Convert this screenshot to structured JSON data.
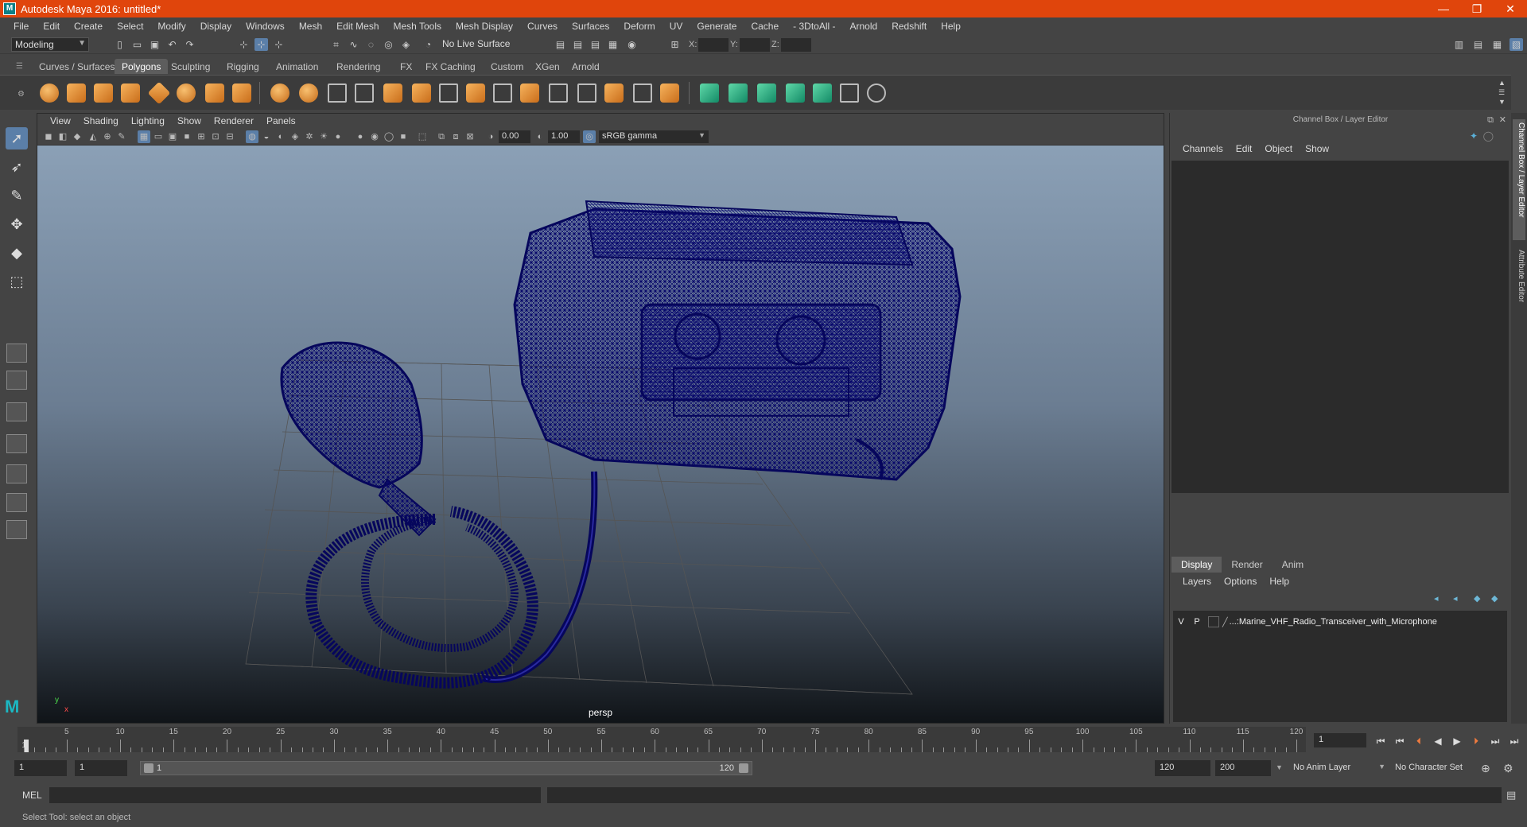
{
  "window": {
    "title": "Autodesk Maya 2016: untitled*",
    "app_icon": "M",
    "minimize": "—",
    "maximize": "❐",
    "close": "✕"
  },
  "menubar": [
    "File",
    "Edit",
    "Create",
    "Select",
    "Modify",
    "Display",
    "Windows",
    "Mesh",
    "Edit Mesh",
    "Mesh Tools",
    "Mesh Display",
    "Curves",
    "Surfaces",
    "Deform",
    "UV",
    "Generate",
    "Cache",
    "- 3DtoAll -",
    "Arnold",
    "Redshift",
    "Help"
  ],
  "statusline": {
    "menuset": "Modeling",
    "live_surface": "No Live Surface",
    "x_label": "X:",
    "y_label": "Y:",
    "z_label": "Z:"
  },
  "shelf_tabs": [
    "Curves / Surfaces",
    "Polygons",
    "Sculpting",
    "Rigging",
    "Animation",
    "Rendering",
    "FX",
    "FX Caching",
    "Custom",
    "XGen",
    "Arnold"
  ],
  "shelf_active_tab": "Polygons",
  "viewport": {
    "menus": [
      "View",
      "Shading",
      "Lighting",
      "Show",
      "Renderer",
      "Panels"
    ],
    "exposure": "0.00",
    "gamma": "1.00",
    "color_space": "sRGB gamma",
    "camera": "persp",
    "axis_y": "y",
    "axis_x": "x"
  },
  "channel_box": {
    "title": "Channel Box / Layer Editor",
    "menus": [
      "Channels",
      "Edit",
      "Object",
      "Show"
    ]
  },
  "layer_editor": {
    "tabs": [
      "Display",
      "Render",
      "Anim"
    ],
    "active_tab": "Display",
    "menus": [
      "Layers",
      "Options",
      "Help"
    ],
    "layer": {
      "visible": "V",
      "playback": "P",
      "name": "...:Marine_VHF_Radio_Transceiver_with_Microphone"
    }
  },
  "side_tabs": [
    "Channel Box / Layer Editor",
    "Attribute Editor"
  ],
  "timeslider": {
    "ticks": [
      "5",
      "10",
      "15",
      "20",
      "25",
      "30",
      "35",
      "40",
      "45",
      "50",
      "55",
      "60",
      "65",
      "70",
      "75",
      "80",
      "85",
      "90",
      "95",
      "100",
      "105",
      "110",
      "115",
      "120"
    ],
    "start_tick": "1",
    "current_frame": "1",
    "range_max": 120
  },
  "rangeslider": {
    "start": "1",
    "playback_start": "1",
    "range_start_label": "1",
    "range_end_label": "120",
    "playback_end": "120",
    "end": "200",
    "anim_layer": "No Anim Layer",
    "character_set": "No Character Set"
  },
  "command_line": {
    "label": "MEL",
    "value": ""
  },
  "help_line": "Select Tool: select an object",
  "colors": {
    "titlebar": "#e0450c",
    "wireframe": "#0a0a6a",
    "active_highlight": "#5b7fa8"
  }
}
